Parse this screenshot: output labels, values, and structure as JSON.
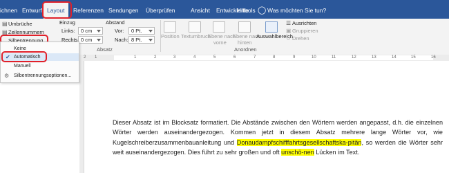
{
  "tabs": [
    "ichnen",
    "Entwurf",
    "Layout",
    "Referenzen",
    "Sendungen",
    "Überprüfen",
    "Ansicht",
    "Entwicklertools",
    "Hilfe"
  ],
  "tell_me": "Was möchten Sie tun?",
  "ribbon": {
    "umbrueche": "Umbrüche",
    "zeilennummern": "Zeilennummern",
    "silbentrennung": "Silbentrennung",
    "einzug_title": "Einzug",
    "links_label": "Links:",
    "links_value": "0 cm",
    "rechts_label": "Rechts:",
    "rechts_value": "0 cm",
    "abstand_title": "Abstand",
    "vor_label": "Vor:",
    "vor_value": "0 Pt.",
    "nach_label": "Nach:",
    "nach_value": "8 Pt.",
    "position": "Position",
    "textumbruch": "Textumbruch",
    "ebene_vorne_1": "Ebene nach",
    "ebene_vorne_2": "vorne",
    "ebene_hinten_1": "Ebene nach",
    "ebene_hinten_2": "hinten",
    "auswahlbereich": "Auswahlbereich",
    "ausrichten": "Ausrichten",
    "gruppieren": "Gruppieren",
    "drehen": "Drehen",
    "group_absatz": "Absatz",
    "group_anordnen": "Anordnen"
  },
  "menu": {
    "items": [
      "Keine",
      "Automatisch",
      "Manuell",
      "Silbentrennungsoptionen..."
    ],
    "checked_index": 1
  },
  "ruler": {
    "labels": [
      "1",
      "2",
      "1",
      "2",
      "3",
      "4",
      "5",
      "6",
      "7",
      "8",
      "9",
      "10",
      "11",
      "12",
      "13",
      "14",
      "15",
      "16"
    ]
  },
  "document": {
    "p1": "Dieser Absatz ist im Blocksatz formatiert. Die Abstände zwischen den Wörtern werden angepasst, d.h. die einzelnen Wörter werden auseinandergezogen. Kommen jetzt in diesem Absatz mehrere lange Wörter vor, wie Kugelschreiberzusammenbauanleitung und ",
    "hl1": "Donaudampfschifffahrtsgesellschafts­ka-pitän",
    "p2": ", so werden die Wörter sehr weit auseinandergezogen. Dies führt zu sehr großen und oft ",
    "hl2": "unschö-nen",
    "p3": " Lücken im Text."
  },
  "colors": {
    "accent": "#2b579a",
    "highlight": "#ffff00",
    "callout": "#e0202a"
  }
}
